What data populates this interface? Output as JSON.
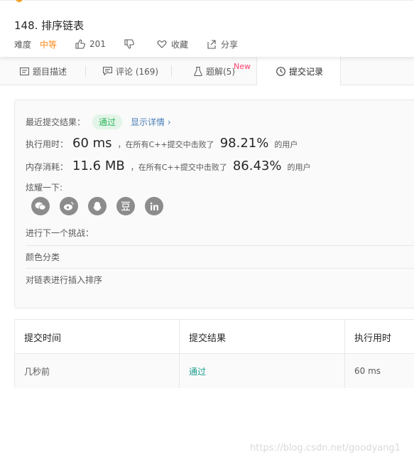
{
  "problem": {
    "title": "148. 排序链表",
    "difficulty_label": "难度",
    "difficulty": "中等",
    "likes": "201",
    "favorite_label": "收藏",
    "share_label": "分享"
  },
  "tabs": [
    {
      "label": "题目描述",
      "icon": "description-icon"
    },
    {
      "label": "评论 (169)",
      "icon": "comment-icon"
    },
    {
      "label": "题解(5)",
      "icon": "flask-icon",
      "badge": "New"
    },
    {
      "label": "提交记录",
      "icon": "clock-icon",
      "active": true
    }
  ],
  "result": {
    "recent_label": "最近提交结果：",
    "status": "通过",
    "detail_link": "显示详情 ›",
    "runtime_label": "执行用时：",
    "runtime_value": "60 ms",
    "runtime_text": "，在所有C++提交中击败了",
    "runtime_pct": "98.21%",
    "runtime_suffix": "的用户",
    "memory_label": "内存消耗：",
    "memory_value": "11.6 MB",
    "memory_text": "，在所有C++提交中击败了",
    "memory_pct": "86.43%",
    "memory_suffix": "的用户",
    "share_label": "炫耀一下:",
    "share_icons": [
      "wechat-icon",
      "weibo-icon",
      "qq-icon",
      "douban-icon",
      "linkedin-icon"
    ],
    "next_label": "进行下一个挑战：",
    "next_items": [
      "颜色分类",
      "对链表进行插入排序"
    ]
  },
  "table": {
    "headers": [
      "提交时间",
      "提交结果",
      "执行用时"
    ],
    "rows": [
      [
        "几秒前",
        "通过",
        "60 ms"
      ]
    ]
  },
  "watermark": "https://blog.csdn.net/goodyang1",
  "colors": {
    "accent_orange": "#ff8c1a",
    "pass_green": "#2db55d",
    "link_blue": "#4a7fb8",
    "teal": "#1a9c8c",
    "new_pink": "#ff3d6c"
  }
}
